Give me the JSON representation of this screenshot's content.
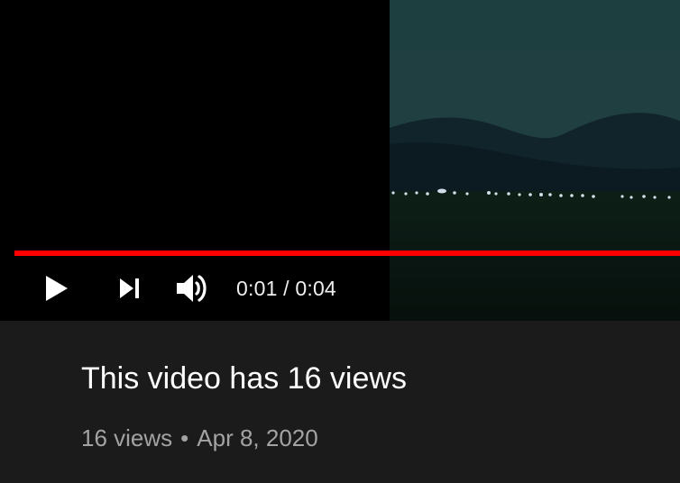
{
  "player": {
    "current_time": "0:01",
    "duration": "0:04",
    "time_separator": " / ",
    "progress_fraction": 1.0,
    "colors": {
      "progress": "#ff0000",
      "background": "#000000"
    },
    "icons": {
      "play": "play-icon",
      "next": "next-icon",
      "volume": "volume-icon"
    }
  },
  "video": {
    "title": "This video has 16 views",
    "views": "16 views",
    "separator": "•",
    "date": "Apr 8, 2020"
  }
}
